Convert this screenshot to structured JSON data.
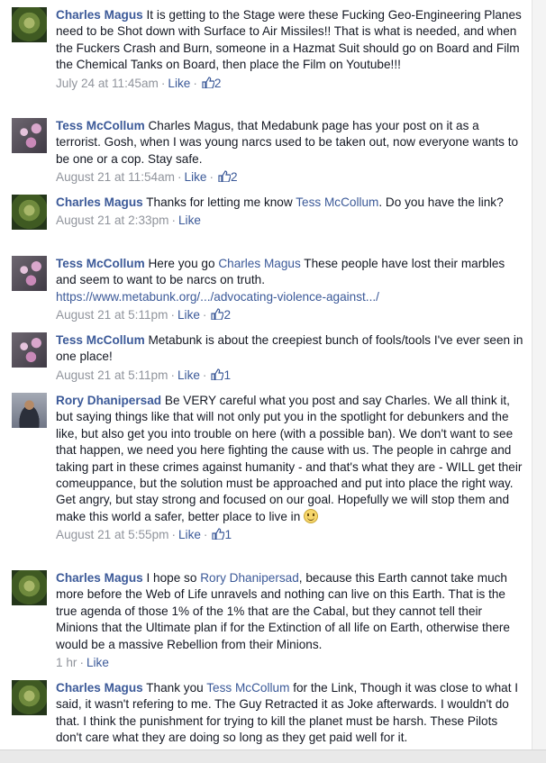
{
  "comments": [
    {
      "author": "Charles Magus",
      "text": "It is getting to the Stage were these Fucking Geo-Engineering Planes need to be Shot down with Surface to Air Missiles!! That is what is needed, and when the Fuckers Crash and Burn, someone in a Hazmat Suit should go on Board and Film the Chemical Tanks on Board, then place the Film on Youtube!!!",
      "time": "July 24 at 11:45am",
      "like_label": "Like",
      "likes": "2"
    },
    {
      "author": "Tess McCollum",
      "text": "Charles Magus, that Medabunk page has your post on it as a terrorist. Gosh, when I was young narcs used to be taken out, now everyone wants to be one or a cop. Stay safe.",
      "time": "August 21 at 11:54am",
      "like_label": "Like",
      "likes": "2"
    },
    {
      "author": "Charles Magus",
      "text_before": "Thanks for letting me know",
      "mention": "Tess McCollum",
      "text_after": ". Do you have the link?",
      "time": "August 21 at 2:33pm",
      "like_label": "Like"
    },
    {
      "author": "Tess McCollum",
      "text_before": "Here you go",
      "mention": "Charles Magus",
      "text_after": "These people have lost their marbles and seem to want to be narcs on truth.",
      "url": "https://www.metabunk.org/.../advocating-violence-against.../",
      "time": "August 21 at 5:11pm",
      "like_label": "Like",
      "likes": "2"
    },
    {
      "author": "Tess McCollum",
      "text": "Metabunk is about the creepiest bunch of fools/tools I've ever seen in one place!",
      "time": "August 21 at 5:11pm",
      "like_label": "Like",
      "likes": "1"
    },
    {
      "author": "Rory Dhanipersad",
      "text": "Be VERY careful what you post and say Charles. We all think it, but saying things like that will not only put you in the spotlight for debunkers and the like, but also get you into trouble on here (with a possible ban). We don't want to see that happen, we need you here fighting the cause with us. The people in cahrge and taking part in these crimes against humanity - and that's what they are - WILL get their comeuppance, but the solution must be approached and put into place the right way. Get angry, but stay strong and focused on our goal. Hopefully we will stop them and make this world a safer, better place to live in",
      "emoji": "smile-emoticon",
      "time": "August 21 at 5:55pm",
      "like_label": "Like",
      "likes": "1"
    },
    {
      "author": "Charles Magus",
      "text_before": "I hope so",
      "mention": "Rory Dhanipersad",
      "text_after": ", because this Earth cannot take much more before the Web of Life unravels and nothing can live on this Earth. That is the true agenda of those 1% of the 1% that are the Cabal, but they cannot tell their Minions that the Ultimate plan if for the Extinction of all life on Earth, otherwise there would be a massive Rebellion from their Minions.",
      "time": "1 hr",
      "like_label": "Like"
    },
    {
      "author": "Charles Magus",
      "text_before": "Thank you",
      "mention": "Tess McCollum",
      "text_after": "for the Link, Though it was close to what I said, it wasn't refering to me. The Guy Retracted it as Joke afterwards. I wouldn't do that. I think the punishment for trying to kill the planet must be harsh. These Pilots don't care what they are doing so long as they get paid well for it."
    }
  ],
  "colors": {
    "link": "#3b5998",
    "meta": "#90949c",
    "text": "#141823"
  }
}
